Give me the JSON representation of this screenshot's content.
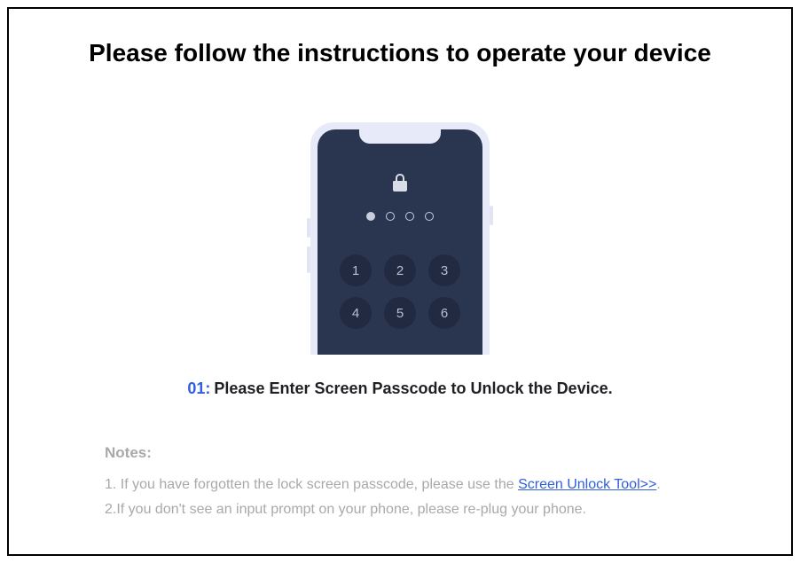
{
  "title": "Please follow the instructions to operate your device",
  "phone": {
    "keys": [
      "1",
      "2",
      "3",
      "4",
      "5",
      "6"
    ],
    "passcode_dots_total": 4,
    "passcode_dots_filled": 1
  },
  "step": {
    "number": "01:",
    "text": "Please Enter Screen Passcode to Unlock the Device."
  },
  "notes": {
    "heading": "Notes:",
    "items": [
      {
        "prefix": "1. If you have forgotten the lock screen passcode, please use the ",
        "link": "Screen Unlock Tool>>",
        "suffix": "."
      },
      {
        "prefix": "2.If you don't see an input prompt on your phone, please re-plug your phone.",
        "link": "",
        "suffix": ""
      }
    ]
  }
}
